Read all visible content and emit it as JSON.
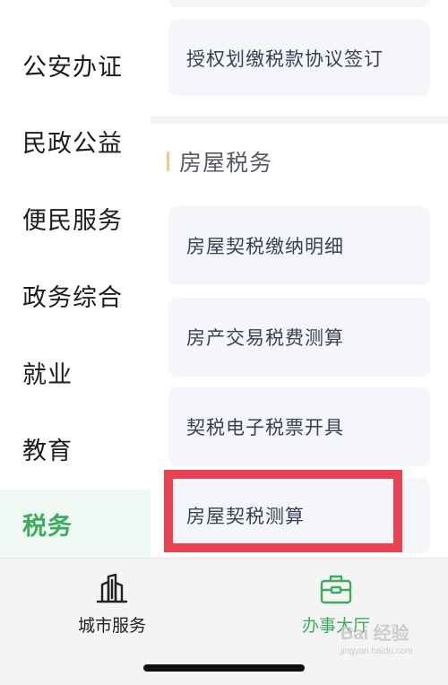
{
  "sidebar": {
    "items": [
      {
        "label": "公安办证",
        "active": false
      },
      {
        "label": "民政公益",
        "active": false
      },
      {
        "label": "便民服务",
        "active": false
      },
      {
        "label": "政务综合",
        "active": false
      },
      {
        "label": "就业",
        "active": false
      },
      {
        "label": "教育",
        "active": false
      },
      {
        "label": "税务",
        "active": true
      }
    ]
  },
  "content": {
    "top_card": {
      "label": "授权划缴税款协议签订"
    },
    "section": {
      "title": "房屋税务"
    },
    "cards": [
      {
        "label": "房屋契税缴纳明细"
      },
      {
        "label": "房产交易税费测算"
      },
      {
        "label": "契税电子税票开具"
      },
      {
        "label": "房屋契税测算",
        "highlighted": true
      }
    ]
  },
  "tabbar": {
    "tabs": [
      {
        "label": "城市服务",
        "icon": "city-buildings-icon",
        "active": false
      },
      {
        "label": "办事大厅",
        "icon": "briefcase-icon",
        "active": true
      }
    ]
  },
  "watermark": {
    "main": "Bai 经验",
    "sub": "jingyan.baidu.com"
  },
  "colors": {
    "accent": "#3cad5c",
    "highlight": "#e84152",
    "section_bar": "#f0c98a"
  }
}
